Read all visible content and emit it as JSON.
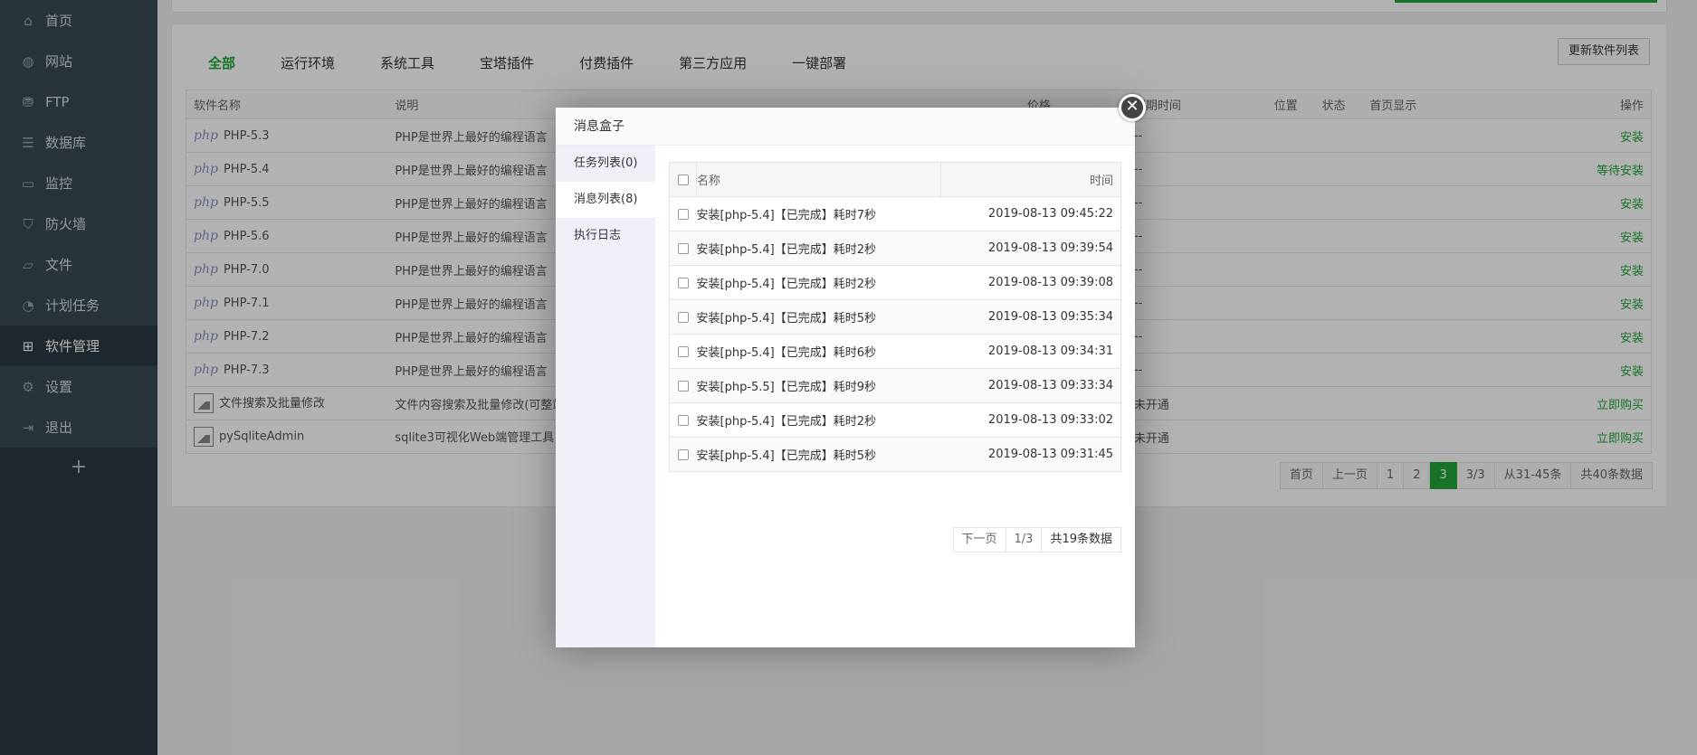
{
  "sidebar": {
    "items": [
      {
        "label": "首页",
        "icon": "home-icon",
        "glyph": "⌂"
      },
      {
        "label": "网站",
        "icon": "globe-icon",
        "glyph": "◍"
      },
      {
        "label": "FTP",
        "icon": "ftp-icon",
        "glyph": "⛃"
      },
      {
        "label": "数据库",
        "icon": "database-icon",
        "glyph": "☰"
      },
      {
        "label": "监控",
        "icon": "monitor-icon",
        "glyph": "▭"
      },
      {
        "label": "防火墙",
        "icon": "shield-icon",
        "glyph": "⛉"
      },
      {
        "label": "文件",
        "icon": "folder-icon",
        "glyph": "▱"
      },
      {
        "label": "计划任务",
        "icon": "clock-icon",
        "glyph": "◔"
      },
      {
        "label": "软件管理",
        "icon": "grid-icon",
        "glyph": "⊞"
      },
      {
        "label": "设置",
        "icon": "gear-icon",
        "glyph": "⚙"
      },
      {
        "label": "退出",
        "icon": "logout-icon",
        "glyph": "⇥"
      }
    ],
    "add_glyph": "+"
  },
  "tabs": [
    "全部",
    "运行环境",
    "系统工具",
    "宝塔插件",
    "付费插件",
    "第三方应用",
    "一键部署"
  ],
  "refresh_label": "更新软件列表",
  "table": {
    "headers": [
      "软件名称",
      "说明",
      "价格",
      "到期时间",
      "位置",
      "状态",
      "首页显示",
      "操作"
    ],
    "rows": [
      {
        "name": "PHP-5.3",
        "desc": "PHP是世界上最好的编程语言",
        "expire": "--",
        "op": "安装",
        "logo": "php"
      },
      {
        "name": "PHP-5.4",
        "desc": "PHP是世界上最好的编程语言",
        "expire": "--",
        "op": "等待安装",
        "logo": "php"
      },
      {
        "name": "PHP-5.5",
        "desc": "PHP是世界上最好的编程语言",
        "expire": "--",
        "op": "安装",
        "logo": "php"
      },
      {
        "name": "PHP-5.6",
        "desc": "PHP是世界上最好的编程语言",
        "expire": "--",
        "op": "安装",
        "logo": "php"
      },
      {
        "name": "PHP-7.0",
        "desc": "PHP是世界上最好的编程语言",
        "expire": "--",
        "op": "安装",
        "logo": "php"
      },
      {
        "name": "PHP-7.1",
        "desc": "PHP是世界上最好的编程语言",
        "expire": "--",
        "op": "安装",
        "logo": "php"
      },
      {
        "name": "PHP-7.2",
        "desc": "PHP是世界上最好的编程语言",
        "expire": "--",
        "op": "安装",
        "logo": "php"
      },
      {
        "name": "PHP-7.3",
        "desc": "PHP是世界上最好的编程语言",
        "expire": "--",
        "op": "安装",
        "logo": "php"
      },
      {
        "name": "文件搜索及批量修改",
        "desc": "文件内容搜索及批量修改(可整站",
        "expire": "未开通",
        "op": "立即购买",
        "logo": "plugin"
      },
      {
        "name": "pySqliteAdmin",
        "desc": "sqlite3可视化Web端管理工具",
        "expire": "未开通",
        "op": "立即购买",
        "logo": "plugin"
      }
    ],
    "php_logo_text": "php",
    "help_glyph": "?"
  },
  "pager": [
    "首页",
    "上一页",
    "1",
    "2",
    "3",
    "3/3",
    "从31-45条",
    "共40条数据"
  ],
  "modal": {
    "title": "消息盒子",
    "close_glyph": "✕",
    "side": [
      "任务列表(0)",
      "消息列表(8)",
      "执行日志"
    ],
    "headers": [
      "名称",
      "时间"
    ],
    "messages": [
      {
        "name": "安装[php-5.4]【已完成】耗时7秒",
        "time": "2019-08-13 09:45:22"
      },
      {
        "name": "安装[php-5.4]【已完成】耗时2秒",
        "time": "2019-08-13 09:39:54"
      },
      {
        "name": "安装[php-5.4]【已完成】耗时2秒",
        "time": "2019-08-13 09:39:08"
      },
      {
        "name": "安装[php-5.4]【已完成】耗时5秒",
        "time": "2019-08-13 09:35:34"
      },
      {
        "name": "安装[php-5.4]【已完成】耗时6秒",
        "time": "2019-08-13 09:34:31"
      },
      {
        "name": "安装[php-5.5]【已完成】耗时9秒",
        "time": "2019-08-13 09:33:34"
      },
      {
        "name": "安装[php-5.4]【已完成】耗时2秒",
        "time": "2019-08-13 09:33:02"
      },
      {
        "name": "安装[php-5.4]【已完成】耗时5秒",
        "time": "2019-08-13 09:31:45"
      }
    ],
    "pager": [
      "下一页",
      "1/3",
      "共19条数据"
    ]
  },
  "colors": {
    "accent": "#20a53a",
    "sidebar": "#2c3a42"
  }
}
